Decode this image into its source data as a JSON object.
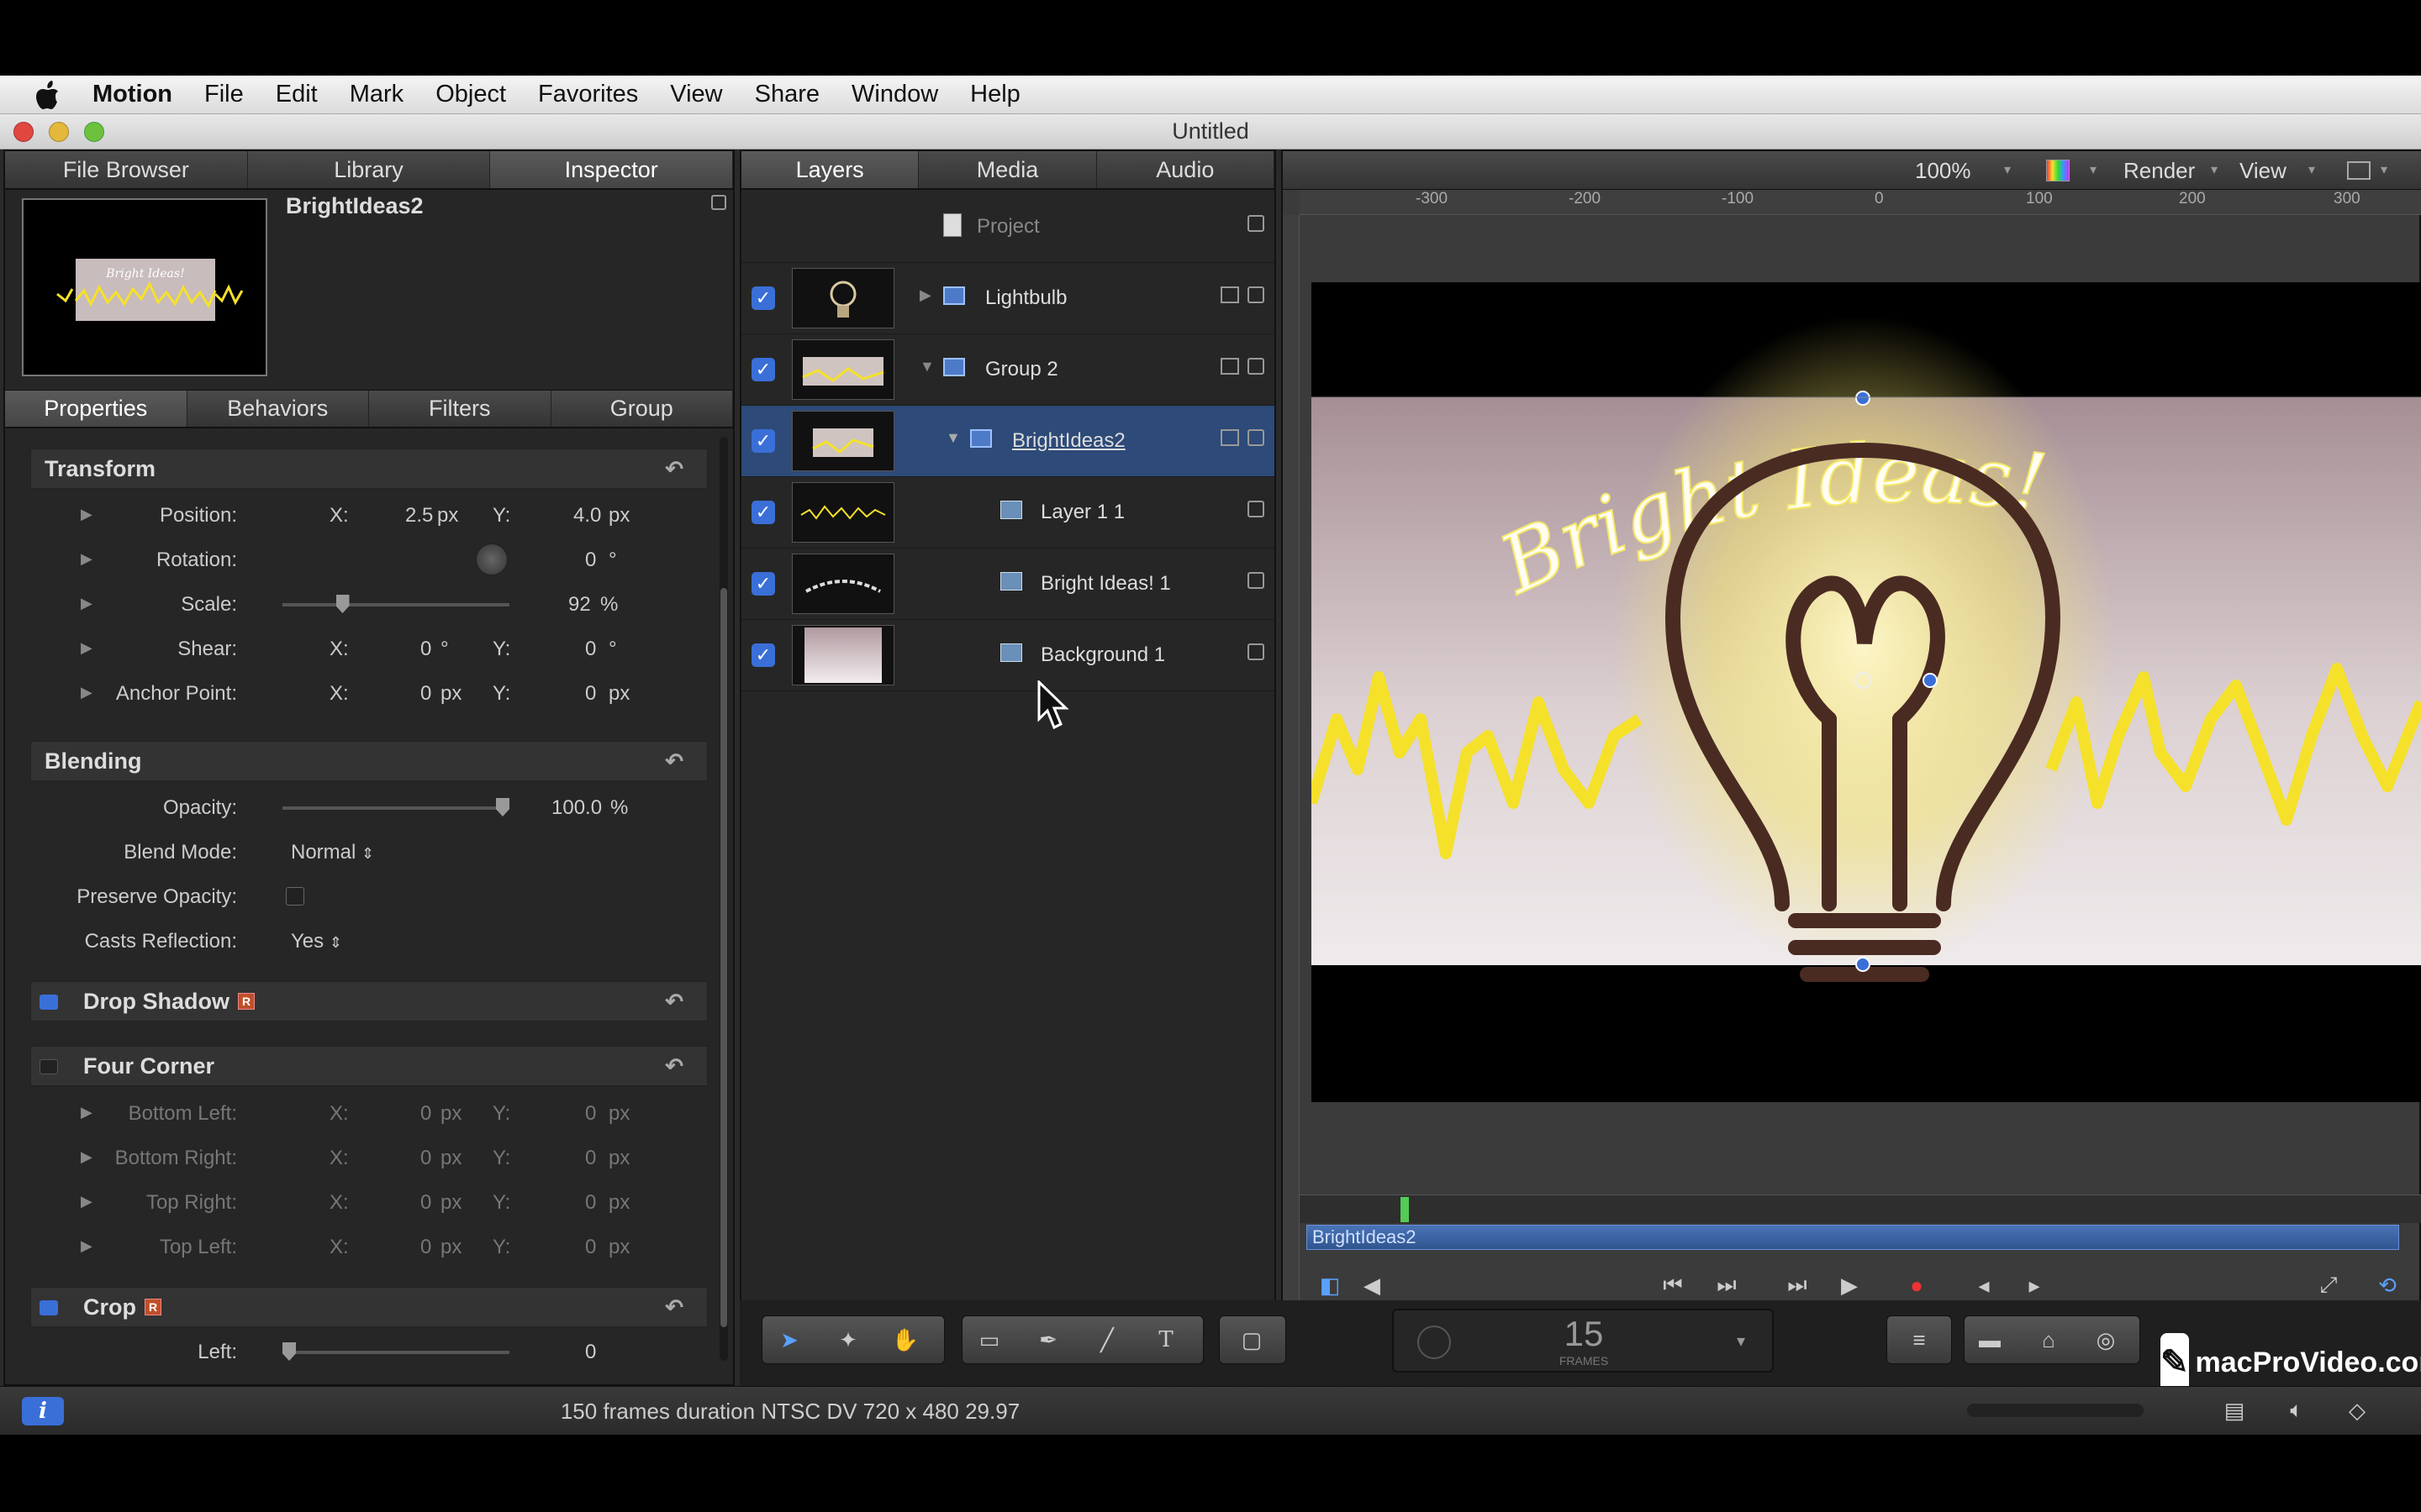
{
  "menubar": {
    "app": "Motion",
    "items": [
      "File",
      "Edit",
      "Mark",
      "Object",
      "Favorites",
      "View",
      "Share",
      "Window",
      "Help"
    ]
  },
  "window": {
    "title": "Untitled"
  },
  "left_tabs": [
    "File Browser",
    "Library",
    "Inspector"
  ],
  "inspector": {
    "object_name": "BrightIdeas2",
    "preview_text": "Bright Ideas!",
    "subtabs": [
      "Properties",
      "Behaviors",
      "Filters",
      "Group"
    ],
    "transform": {
      "title": "Transform",
      "position": {
        "label": "Position:",
        "x_label": "X:",
        "x": "2.5",
        "x_unit": "px",
        "y_label": "Y:",
        "y": "4.0",
        "y_unit": "px"
      },
      "rotation": {
        "label": "Rotation:",
        "value": "0",
        "unit": "°"
      },
      "scale": {
        "label": "Scale:",
        "value": "92",
        "unit": "%",
        "fraction": 0.25
      },
      "shear": {
        "label": "Shear:",
        "x_label": "X:",
        "x": "0",
        "x_unit": "°",
        "y_label": "Y:",
        "y": "0",
        "y_unit": "°"
      },
      "anchor": {
        "label": "Anchor Point:",
        "x_label": "X:",
        "x": "0",
        "x_unit": "px",
        "y_label": "Y:",
        "y": "0",
        "y_unit": "px"
      }
    },
    "blending": {
      "title": "Blending",
      "opacity": {
        "label": "Opacity:",
        "value": "100.0",
        "unit": "%",
        "fraction": 1.0
      },
      "blend_mode": {
        "label": "Blend Mode:",
        "value": "Normal"
      },
      "preserve_opacity": {
        "label": "Preserve Opacity:"
      },
      "casts_reflection": {
        "label": "Casts Reflection:",
        "value": "Yes"
      }
    },
    "drop_shadow": {
      "title": "Drop Shadow"
    },
    "four_corner": {
      "title": "Four Corner",
      "rows": [
        {
          "label": "Bottom Left:",
          "x_label": "X:",
          "x": "0",
          "x_unit": "px",
          "y_label": "Y:",
          "y": "0",
          "y_unit": "px"
        },
        {
          "label": "Bottom Right:",
          "x_label": "X:",
          "x": "0",
          "x_unit": "px",
          "y_label": "Y:",
          "y": "0",
          "y_unit": "px"
        },
        {
          "label": "Top Right:",
          "x_label": "X:",
          "x": "0",
          "x_unit": "px",
          "y_label": "Y:",
          "y": "0",
          "y_unit": "px"
        },
        {
          "label": "Top Left:",
          "x_label": "X:",
          "x": "0",
          "x_unit": "px",
          "y_label": "Y:",
          "y": "0",
          "y_unit": "px"
        }
      ]
    },
    "crop": {
      "title": "Crop",
      "left": {
        "label": "Left:",
        "value": "0"
      }
    }
  },
  "layers_tabs": [
    "Layers",
    "Media",
    "Audio"
  ],
  "layers": {
    "project": "Project",
    "rows": [
      {
        "name": "Lightbulb"
      },
      {
        "name": "Group 2"
      },
      {
        "name": "BrightIdeas2"
      },
      {
        "name": "Layer 1 1"
      },
      {
        "name": "Bright Ideas! 1"
      },
      {
        "name": "Background 1"
      }
    ]
  },
  "canvas": {
    "zoom": "100%",
    "render": "Render",
    "view": "View",
    "ruler_labels": [
      "-300",
      "-200",
      "-100",
      "0",
      "100",
      "200",
      "300"
    ],
    "title_text": "Bright Ideas!"
  },
  "timeline": {
    "clip_name": "BrightIdeas2"
  },
  "framerate": {
    "value": "15",
    "unit": "FRAMES"
  },
  "status": {
    "text": "150 frames duration NTSC DV 720 x 480 29.97"
  },
  "watermark": {
    "text": "macProVideo.com"
  },
  "colors": {
    "accent": "#3a6fd8",
    "glow": "#f6e86a",
    "wave": "#f5e12a",
    "bulb": "#4a2b22"
  }
}
